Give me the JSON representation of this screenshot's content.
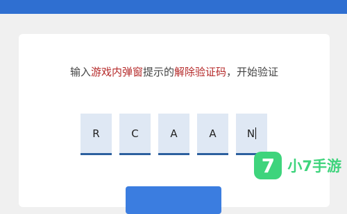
{
  "instruction": {
    "part1": "输入",
    "highlight1": "游戏内弹窗",
    "part2": "提示的",
    "highlight2": "解除验证码",
    "part3": "，开始验证"
  },
  "code": {
    "chars": [
      "R",
      "C",
      "A",
      "A",
      "N"
    ]
  },
  "watermark": {
    "badge": "7",
    "text": "小7手游"
  },
  "colors": {
    "topbar": "#2f6fd1",
    "highlight": "#b52a2a",
    "code_box": "#dfe8f4",
    "code_underline": "#2c5f9e",
    "submit_button": "#3b7de0",
    "watermark": "#3ed47c"
  }
}
